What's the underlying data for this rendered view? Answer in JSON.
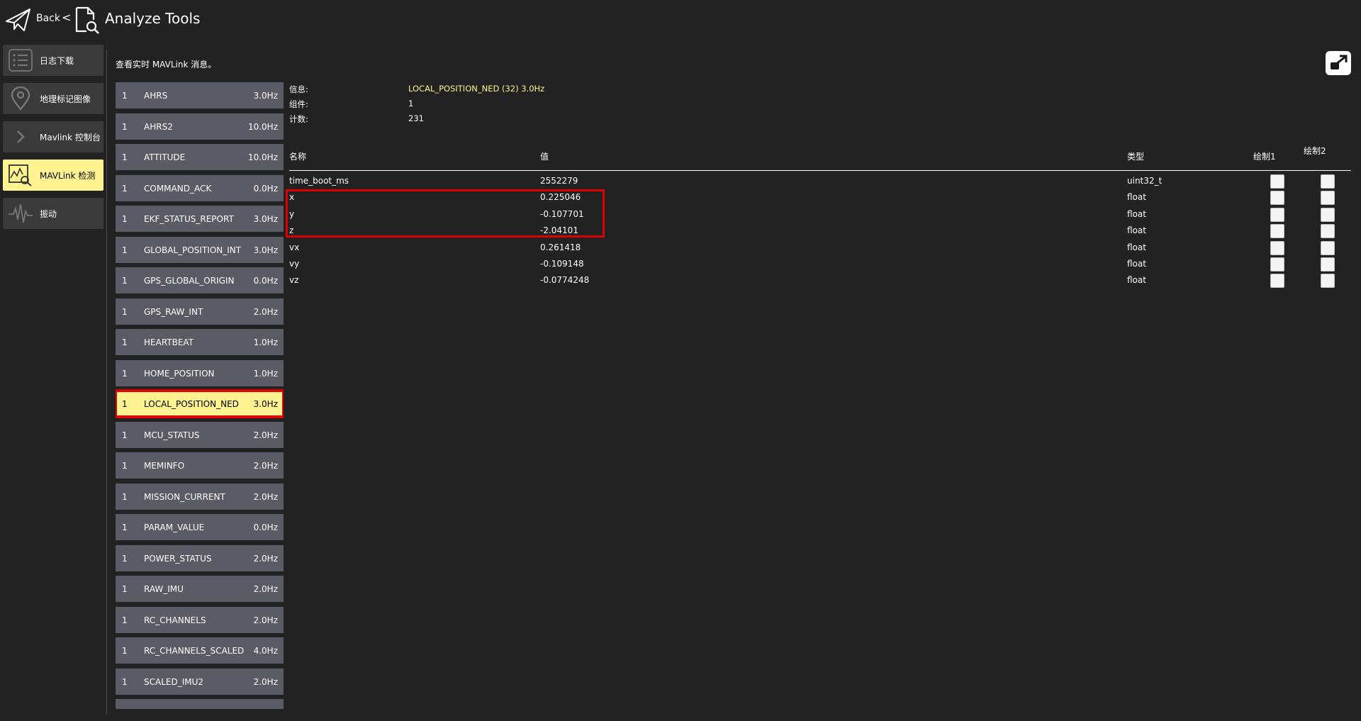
{
  "header": {
    "back_label": "Back",
    "chevron": "<",
    "title": "Analyze Tools",
    "back_icon": "paper-plane-icon",
    "tool_icon": "document-search-icon"
  },
  "sidebar": {
    "items": [
      {
        "label": "日志下载",
        "icon": "list-icon",
        "active": false
      },
      {
        "label": "地理标记图像",
        "icon": "map-pin-icon",
        "active": false
      },
      {
        "label": "Mavlink 控制台",
        "icon": "chevron-right-icon",
        "active": false
      },
      {
        "label": "MAVLink 检测",
        "icon": "chart-magnifier-icon",
        "active": true
      },
      {
        "label": "振动",
        "icon": "waveform-icon",
        "active": false
      }
    ]
  },
  "description": "查看实时 MAVLink 消息。",
  "messages": [
    {
      "id": "1",
      "name": "AHRS",
      "rate": "3.0Hz"
    },
    {
      "id": "1",
      "name": "AHRS2",
      "rate": "10.0Hz"
    },
    {
      "id": "1",
      "name": "ATTITUDE",
      "rate": "10.0Hz"
    },
    {
      "id": "1",
      "name": "COMMAND_ACK",
      "rate": "0.0Hz"
    },
    {
      "id": "1",
      "name": "EKF_STATUS_REPORT",
      "rate": "3.0Hz"
    },
    {
      "id": "1",
      "name": "GLOBAL_POSITION_INT",
      "rate": "3.0Hz"
    },
    {
      "id": "1",
      "name": "GPS_GLOBAL_ORIGIN",
      "rate": "0.0Hz"
    },
    {
      "id": "1",
      "name": "GPS_RAW_INT",
      "rate": "2.0Hz"
    },
    {
      "id": "1",
      "name": "HEARTBEAT",
      "rate": "1.0Hz"
    },
    {
      "id": "1",
      "name": "HOME_POSITION",
      "rate": "1.0Hz"
    },
    {
      "id": "1",
      "name": "LOCAL_POSITION_NED",
      "rate": "3.0Hz",
      "selected": true
    },
    {
      "id": "1",
      "name": "MCU_STATUS",
      "rate": "2.0Hz"
    },
    {
      "id": "1",
      "name": "MEMINFO",
      "rate": "2.0Hz"
    },
    {
      "id": "1",
      "name": "MISSION_CURRENT",
      "rate": "2.0Hz"
    },
    {
      "id": "1",
      "name": "PARAM_VALUE",
      "rate": "0.0Hz"
    },
    {
      "id": "1",
      "name": "POWER_STATUS",
      "rate": "2.0Hz"
    },
    {
      "id": "1",
      "name": "RAW_IMU",
      "rate": "2.0Hz"
    },
    {
      "id": "1",
      "name": "RC_CHANNELS",
      "rate": "2.0Hz"
    },
    {
      "id": "1",
      "name": "RC_CHANNELS_SCALED",
      "rate": "4.0Hz"
    },
    {
      "id": "1",
      "name": "SCALED_IMU2",
      "rate": "2.0Hz"
    },
    {
      "id": "",
      "name": "",
      "rate": ""
    }
  ],
  "info": {
    "message_label": "信息:",
    "message_value": "LOCAL_POSITION_NED (32) 3.0Hz",
    "component_label": "组件:",
    "component_value": "1",
    "count_label": "计数:",
    "count_value": "231"
  },
  "table": {
    "headers": {
      "name": "名称",
      "value": "值",
      "type": "类型",
      "plot1": "绘制1",
      "plot2": "绘制2"
    },
    "rows": [
      {
        "name": "time_boot_ms",
        "value": "2552279",
        "type": "uint32_t"
      },
      {
        "name": "x",
        "value": "0.225046",
        "type": "float"
      },
      {
        "name": "y",
        "value": "-0.107701",
        "type": "float"
      },
      {
        "name": "z",
        "value": "-2.04101",
        "type": "float"
      },
      {
        "name": "vx",
        "value": "0.261418",
        "type": "float"
      },
      {
        "name": "vy",
        "value": "-0.109148",
        "type": "float"
      },
      {
        "name": "vz",
        "value": "-0.0774248",
        "type": "float"
      }
    ]
  },
  "popout_icon": "popout-window-icon",
  "colors": {
    "accent": "#fff291",
    "highlight": "#e00000",
    "list_item": "#5b5b66",
    "background": "#222222"
  }
}
